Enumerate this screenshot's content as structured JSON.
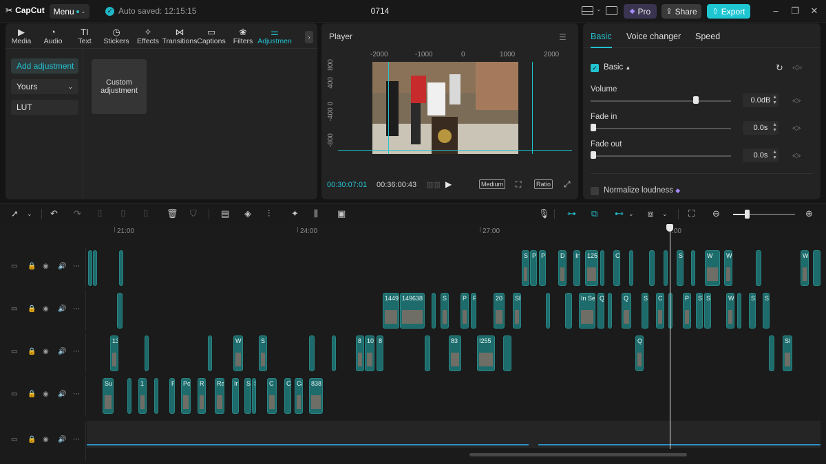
{
  "app": {
    "logo_text": "CapCut",
    "menu_label": "Menu",
    "autosave_text": "Auto saved: 12:15:15",
    "project_title": "0714",
    "pro_label": "Pro",
    "share_label": "Share",
    "export_label": "Export"
  },
  "categories": [
    {
      "label": "Media",
      "icon": "media-icon"
    },
    {
      "label": "Audio",
      "icon": "audio-icon"
    },
    {
      "label": "Text",
      "icon": "text-icon"
    },
    {
      "label": "Stickers",
      "icon": "stickers-icon"
    },
    {
      "label": "Effects",
      "icon": "effects-icon"
    },
    {
      "label": "Transitions",
      "icon": "transitions-icon"
    },
    {
      "label": "Captions",
      "icon": "captions-icon"
    },
    {
      "label": "Filters",
      "icon": "filters-icon"
    },
    {
      "label": "Adjustmen",
      "icon": "adjustment-icon"
    }
  ],
  "adjust_sidebar": {
    "add_label": "Add adjustment",
    "yours_label": "Yours",
    "lut_label": "LUT",
    "custom_card_label": "Custom adjustment"
  },
  "player": {
    "label": "Player",
    "ruler_x": [
      "-2000",
      "-1000",
      "0",
      "1000",
      "2000"
    ],
    "ruler_y": [
      "800",
      "400",
      "-400 0",
      "-800"
    ],
    "current_time": "00:30:07:01",
    "total_time": "00:36:00:43",
    "quality_label": "Medium",
    "ratio_label": "Ratio"
  },
  "right_panel": {
    "tabs": [
      "Basic",
      "Voice changer",
      "Speed"
    ],
    "section_label": "Basic",
    "volume_label": "Volume",
    "volume_value": "0.0dB",
    "volume_level": 0.75,
    "fade_in_label": "Fade in",
    "fade_in_value": "0.0s",
    "fade_out_label": "Fade out",
    "fade_out_value": "0.0s",
    "normalize_label": "Normalize loudness"
  },
  "timeline": {
    "ruler_labels": [
      "21:00",
      "24:00",
      "27:00",
      ":00"
    ],
    "zoom_level": 0.22,
    "tracks": [
      {
        "clips": [
          {
            "label": ""
          },
          {
            "label": ""
          },
          {
            "label": ""
          },
          {
            "label": "S"
          },
          {
            "label": "P"
          },
          {
            "label": "P"
          },
          {
            "label": "D"
          },
          {
            "label": "In"
          },
          {
            "label": "125"
          },
          {
            "label": ""
          },
          {
            "label": "C"
          },
          {
            "label": ""
          },
          {
            "label": ""
          },
          {
            "label": ""
          },
          {
            "label": "S"
          },
          {
            "label": ""
          },
          {
            "label": "W"
          },
          {
            "label": "W"
          },
          {
            "label": ""
          },
          {
            "label": "W"
          },
          {
            "label": ""
          }
        ]
      },
      {
        "clips": [
          {
            "label": ""
          },
          {
            "label": "1449"
          },
          {
            "label": "149638"
          },
          {
            "label": ""
          },
          {
            "label": "S"
          },
          {
            "label": "P"
          },
          {
            "label": "P"
          },
          {
            "label": "20"
          },
          {
            "label": "Sh"
          },
          {
            "label": ""
          },
          {
            "label": ""
          },
          {
            "label": "In Se"
          },
          {
            "label": "Q"
          },
          {
            "label": ""
          },
          {
            "label": "Q"
          },
          {
            "label": "S"
          },
          {
            "label": "C"
          },
          {
            "label": ""
          },
          {
            "label": "P"
          },
          {
            "label": "S"
          },
          {
            "label": "S"
          },
          {
            "label": "W"
          },
          {
            "label": ""
          },
          {
            "label": "S"
          },
          {
            "label": "S"
          }
        ]
      },
      {
        "clips": [
          {
            "label": "13"
          },
          {
            "label": ""
          },
          {
            "label": ""
          },
          {
            "label": "W"
          },
          {
            "label": "S"
          },
          {
            "label": ""
          },
          {
            "label": ""
          },
          {
            "label": "8"
          },
          {
            "label": "10"
          },
          {
            "label": "8"
          },
          {
            "label": ""
          },
          {
            "label": "83"
          },
          {
            "label": "!255"
          },
          {
            "label": ""
          },
          {
            "label": "Q"
          },
          {
            "label": ""
          },
          {
            "label": "Sl"
          }
        ]
      },
      {
        "clips": [
          {
            "label": "Su"
          },
          {
            "label": ""
          },
          {
            "label": "1"
          },
          {
            "label": ""
          },
          {
            "label": "P"
          },
          {
            "label": "Po"
          },
          {
            "label": "R"
          },
          {
            "label": "Ra"
          },
          {
            "label": "In"
          },
          {
            "label": "S"
          },
          {
            "label": "S"
          },
          {
            "label": "C"
          },
          {
            "label": "Co"
          },
          {
            "label": "Cas"
          },
          {
            "label": "838"
          }
        ]
      }
    ]
  }
}
